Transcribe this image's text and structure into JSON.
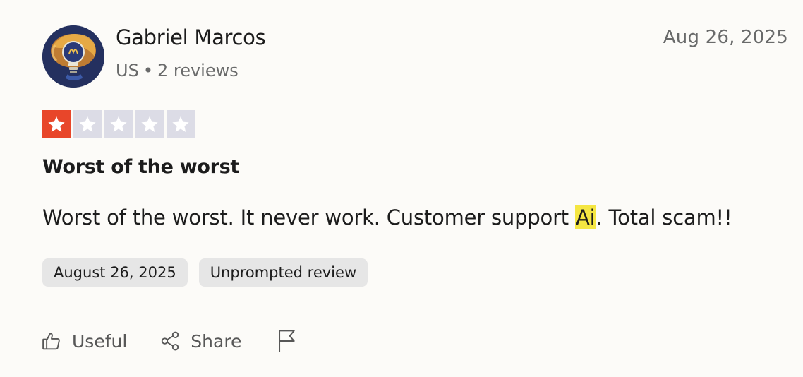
{
  "review": {
    "author": {
      "name": "Gabriel Marcos",
      "country": "US",
      "separator": "•",
      "reviews_count": "2 reviews",
      "avatar_icon": "lightbulb-avatar-icon"
    },
    "date": "Aug 26, 2025",
    "rating": {
      "value": 1,
      "max": 5,
      "filled_color": "#e8462a",
      "empty_color": "#dcdce6"
    },
    "title": "Worst of the worst",
    "text_before": "Worst of the worst. It never work. Customer support ",
    "text_highlight": "Ai",
    "text_after": ". Total scam!!",
    "highlight_color": "#f5e642",
    "tags": [
      "August 26, 2025",
      "Unprompted review"
    ],
    "actions": {
      "useful_label": "Useful",
      "useful_icon": "thumbs-up-icon",
      "share_label": "Share",
      "share_icon": "share-icon",
      "flag_icon": "flag-icon"
    }
  }
}
